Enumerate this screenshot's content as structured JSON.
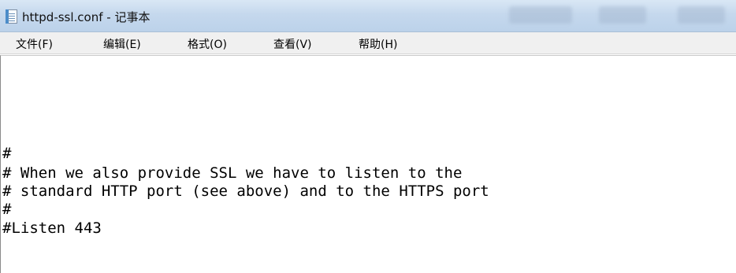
{
  "window": {
    "title": "httpd-ssl.conf - 记事本",
    "icon": "notepad-icon"
  },
  "menu": [
    {
      "label": "文件(F)"
    },
    {
      "label": "编辑(E)"
    },
    {
      "label": "格式(O)"
    },
    {
      "label": "查看(V)"
    },
    {
      "label": "帮助(H)"
    }
  ],
  "editor": {
    "lines": [
      "#",
      "# When we also provide SSL we have to listen to the",
      "# standard HTTP port (see above) and to the HTTPS port",
      "#",
      "#Listen 443"
    ]
  }
}
